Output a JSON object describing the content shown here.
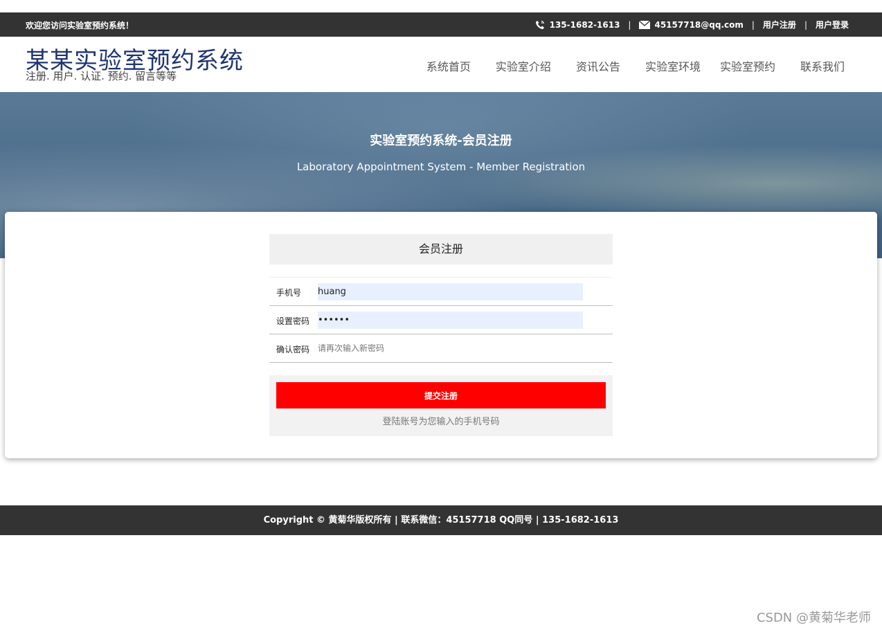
{
  "topbar": {
    "welcome": "欢迎您访问实验室预约系统！",
    "phone_icon": "phone-icon",
    "phone": "135-1682-1613",
    "mail_icon": "mail-icon",
    "email": "45157718@qq.com",
    "register_link": "用户注册",
    "login_link": "用户登录"
  },
  "header": {
    "site_title": "某某实验室预约系统",
    "site_subtitle": "注册. 用户. 认证. 预约. 留言等等",
    "nav": [
      "系统首页",
      "实验室介绍",
      "资讯公告",
      "实验室环境",
      "实验室预约",
      "联系我们"
    ]
  },
  "banner": {
    "title": "实验室预约系统-会员注册",
    "subtitle": "Laboratory Appointment System - Member Registration"
  },
  "form": {
    "heading": "会员注册",
    "phone_label": "手机号",
    "phone_value": "huang",
    "password_label": "设置密码",
    "password_value": "••••••",
    "confirm_label": "确认密码",
    "confirm_placeholder": "请再次输入新密码",
    "submit_label": "提交注册",
    "hint": "登陆账号为您输入的手机号码"
  },
  "footer": {
    "copyright": "Copyright © 黄菊华版权所有 | 联系微信：45157718 QQ同号 | 135-1682-1613"
  },
  "watermark": "CSDN @黄菊华老师",
  "colors": {
    "topbar_bg": "#333333",
    "title_color": "#1f3470",
    "submit_bg": "#ff0000",
    "autofill_bg": "#e8f0fe"
  }
}
